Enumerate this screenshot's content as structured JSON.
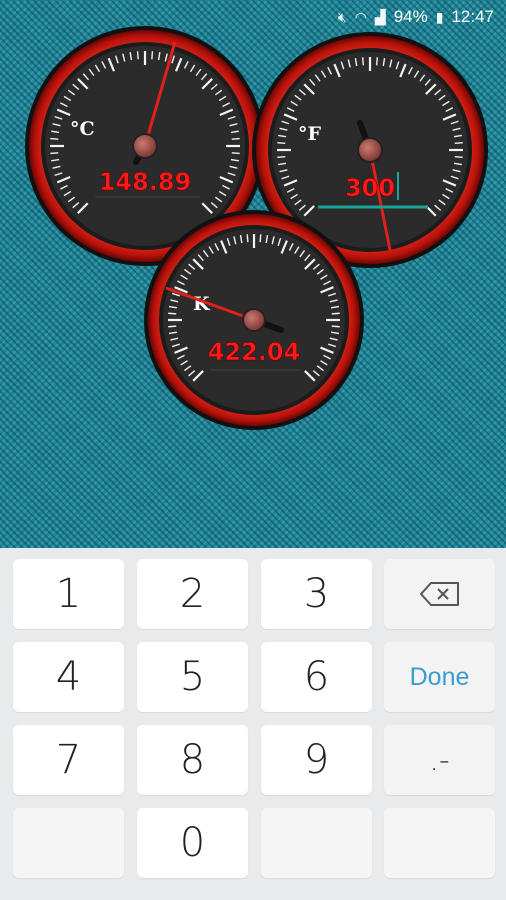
{
  "status_bar": {
    "battery": "94%",
    "time": "12:47",
    "icons": [
      "mute-icon",
      "wifi-icon",
      "signal-icon",
      "battery-icon"
    ]
  },
  "gauges": {
    "celsius": {
      "unit": "°C",
      "value": "148.89"
    },
    "fahrenheit": {
      "unit": "°F",
      "value": "300"
    },
    "kelvin": {
      "unit": "K",
      "value": "422.04"
    }
  },
  "keypad": {
    "keys": [
      "1",
      "2",
      "3",
      "4",
      "5",
      "6",
      "7",
      "8",
      "9",
      "0"
    ],
    "done_label": "Done",
    "dot_minus_label": ".-",
    "backspace_icon": "backspace-icon"
  },
  "colors": {
    "background": "#1e8597",
    "gauge_rim": "#c8160e",
    "gauge_face": "#2b2b2b",
    "value_text": "#ff1a1a",
    "needle": "#e0201a",
    "done_text": "#3a9ccf"
  }
}
